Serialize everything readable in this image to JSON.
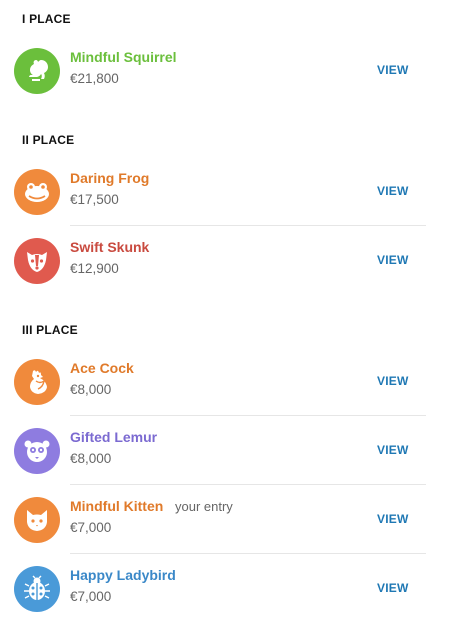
{
  "sections": [
    {
      "title": "I PLACE",
      "entries": [
        {
          "name": "Mindful Squirrel",
          "amount": "€21,800",
          "view": "VIEW",
          "icon": "squirrel-icon",
          "color": "#6bbf3c",
          "name_color": "#6bbf3c"
        }
      ]
    },
    {
      "title": "II PLACE",
      "entries": [
        {
          "name": "Daring Frog",
          "amount": "€17,500",
          "view": "VIEW",
          "icon": "frog-icon",
          "color": "#f08a3c",
          "name_color": "#e07a2a"
        },
        {
          "name": "Swift Skunk",
          "amount": "€12,900",
          "view": "VIEW",
          "icon": "skunk-icon",
          "color": "#e05a4e",
          "name_color": "#c94a3f"
        }
      ]
    },
    {
      "title": "III PLACE",
      "entries": [
        {
          "name": "Ace Cock",
          "amount": "€8,000",
          "view": "VIEW",
          "icon": "rooster-icon",
          "color": "#f08a3c",
          "name_color": "#e07a2a"
        },
        {
          "name": "Gifted Lemur",
          "amount": "€8,000",
          "view": "VIEW",
          "icon": "lemur-icon",
          "color": "#8e7ce0",
          "name_color": "#7b6ad1"
        },
        {
          "name": "Mindful Kitten",
          "amount": "€7,000",
          "view": "VIEW",
          "icon": "kitten-icon",
          "color": "#f08a3c",
          "name_color": "#e07a2a",
          "tag": "your entry"
        },
        {
          "name": "Happy Ladybird",
          "amount": "€7,000",
          "view": "VIEW",
          "icon": "ladybird-icon",
          "color": "#4a9ad8",
          "name_color": "#3a88c8"
        }
      ]
    }
  ]
}
